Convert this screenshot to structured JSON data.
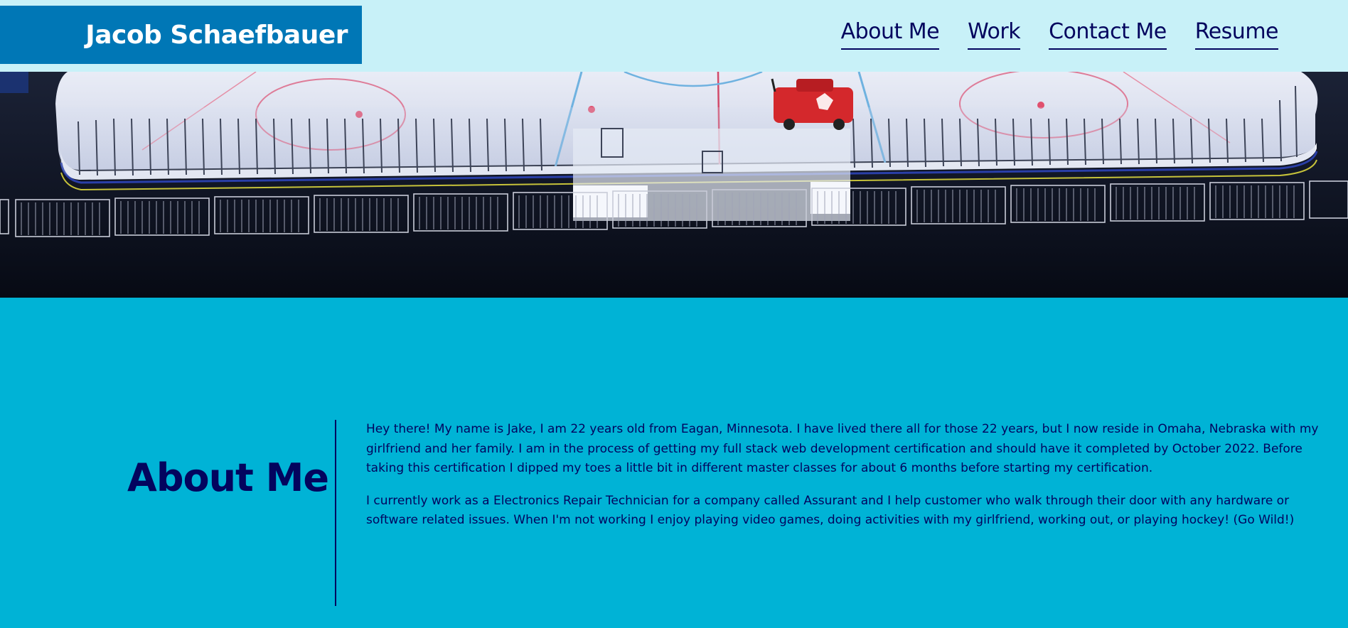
{
  "header": {
    "brand": "Jacob Schaefbauer",
    "nav": [
      {
        "label": "About Me"
      },
      {
        "label": "Work"
      },
      {
        "label": "Contact Me"
      },
      {
        "label": "Resume"
      }
    ]
  },
  "hero": {
    "image_subject": "hockey rink with zamboni"
  },
  "about": {
    "title": "About Me",
    "paragraphs": [
      "Hey there! My name is Jake, I am 22 years old from Eagan, Minnesota. I have lived there all for those 22 years, but I now reside in Omaha, Nebraska with my girlfriend and her family. I am in the process of getting my full stack web development certification and should have it completed by October 2022. Before taking this certification I dipped my toes a little bit in different master classes for about 6 months before starting my certification.",
      "I currently work as a Electronics Repair Technician for a company called Assurant and I help customer who walk through their door with any hardware or software related issues. When I'm not working I enjoy playing video games, doing activities with my girlfriend, working out, or playing hockey! (Go Wild!)"
    ]
  },
  "colors": {
    "header_bg": "#c8f1f8",
    "brand_bg": "#0077b6",
    "section_bg": "#00b3d6",
    "text": "#03045e"
  }
}
